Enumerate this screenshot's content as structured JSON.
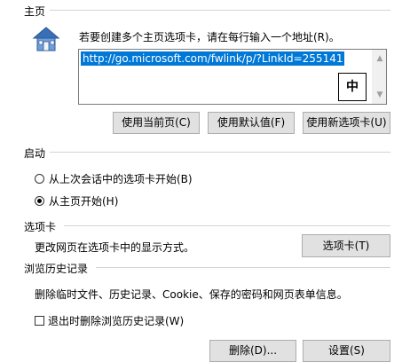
{
  "homepage": {
    "section_title": "主页",
    "instruction": "若要创建多个主页选项卡，请在每行输入一个地址(R)。",
    "url_value": "http://go.microsoft.com/fwlink/p/?LinkId=255141",
    "ime_indicator": "中",
    "buttons": {
      "use_current": "使用当前页(C)",
      "use_default": "使用默认值(F)",
      "use_new_tab": "使用新选项卡(U)"
    }
  },
  "startup": {
    "section_title": "启动",
    "options": [
      {
        "label": "从上次会话中的选项卡开始(B)",
        "checked": false
      },
      {
        "label": "从主页开始(H)",
        "checked": true
      }
    ]
  },
  "tabs": {
    "section_title": "选项卡",
    "description": "更改网页在选项卡中的显示方式。",
    "button": "选项卡(T)"
  },
  "history": {
    "section_title": "浏览历史记录",
    "description": "删除临时文件、历史记录、Cookie、保存的密码和网页表单信息。",
    "checkbox_label": "退出时删除浏览历史记录(W)",
    "checkbox_checked": false,
    "delete_button": "删除(D)...",
    "settings_button": "设置(S)"
  },
  "icons": {
    "home": "home-icon",
    "scroll_up": "scroll-up-arrow-icon",
    "scroll_down": "scroll-down-arrow-icon"
  }
}
